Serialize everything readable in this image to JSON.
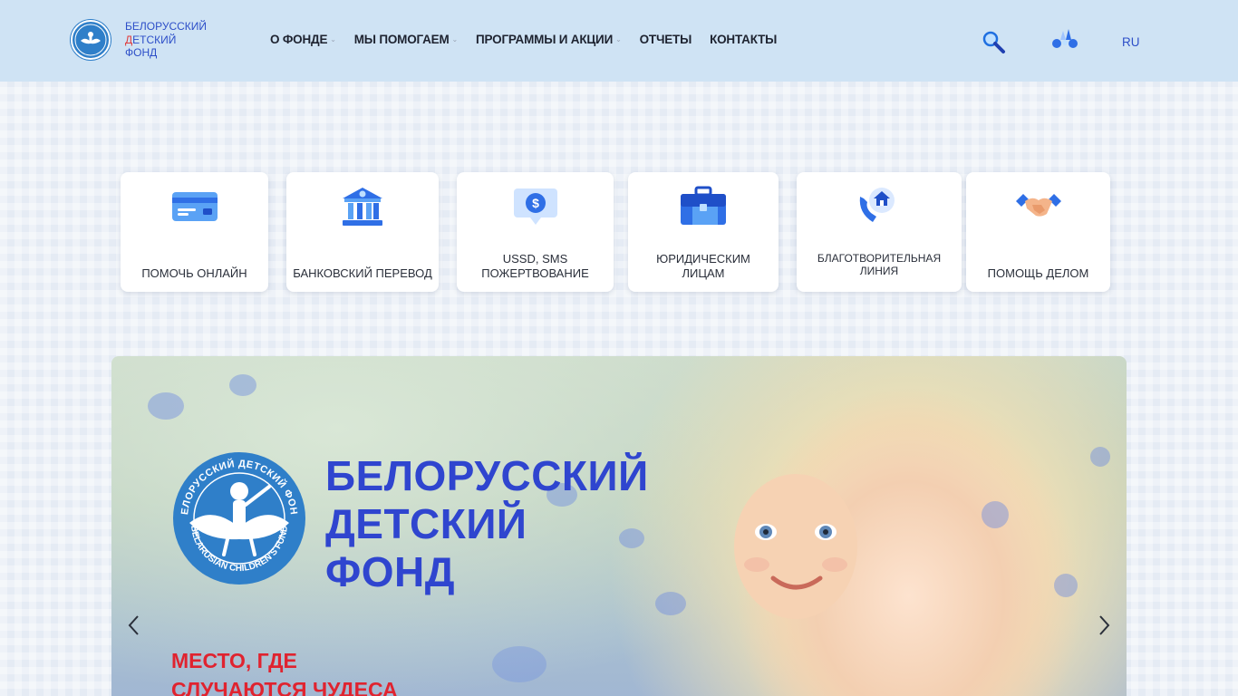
{
  "header": {
    "logo_line1": "Белорусский",
    "logo_line2_first": "Д",
    "logo_line2_rest": "етский",
    "logo_line3": "Фонд",
    "nav": [
      {
        "label": "О фонде",
        "has_dropdown": true
      },
      {
        "label": "Мы помогаем",
        "has_dropdown": true
      },
      {
        "label": "Программы и акции",
        "has_dropdown": true
      },
      {
        "label": "Отчеты",
        "has_dropdown": false
      },
      {
        "label": "Контакты",
        "has_dropdown": false
      }
    ],
    "lang": "RU",
    "search_icon": "search-icon",
    "accessibility_icon": "low-vision-icon"
  },
  "help_cards": [
    {
      "label": "Помочь онлайн",
      "icon": "credit-card-icon"
    },
    {
      "label": "Банковский перевод",
      "icon": "bank-icon"
    },
    {
      "label": "USSD, SMS пожертвование",
      "icon": "sms-dollar-icon"
    },
    {
      "label": "Юридическим лицам",
      "icon": "briefcase-icon"
    },
    {
      "label": "Благотворительная линия",
      "icon": "phone-home-icon"
    },
    {
      "label": "Помощь делом",
      "icon": "handshake-icon"
    }
  ],
  "hero": {
    "title_line1": "Белорусский",
    "title_line2": "детский",
    "title_line3": "фонд",
    "subtitle_line1": "Место, где",
    "subtitle_line2": "случаются чудеса",
    "emblem_text_top": "БЕЛОРУССКИЙ ДЕТСКИЙ ФОНД",
    "emblem_text_bottom": "BELARUSIAN CHILDREN'S FUND"
  },
  "colors": {
    "brand_blue": "#2f45cf",
    "accent_red": "#e0232f",
    "header_bg": "#cfe3f4"
  }
}
